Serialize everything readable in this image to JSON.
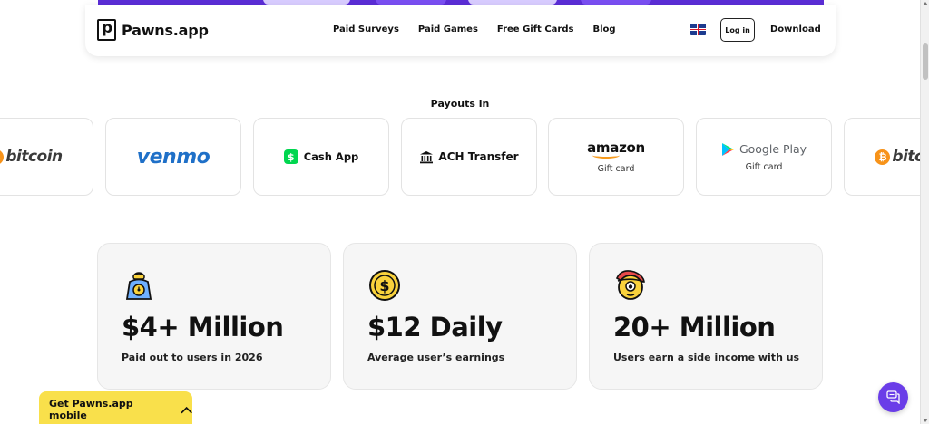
{
  "brand": {
    "name": "Pawns.app"
  },
  "nav": {
    "links": [
      "Paid Surveys",
      "Paid Games",
      "Free Gift Cards",
      "Blog"
    ],
    "language_icon": "uk-flag-icon",
    "login_label": "Log in",
    "download_label": "Download"
  },
  "payouts": {
    "title": "Payouts in",
    "methods": [
      {
        "name": "bitcoin"
      },
      {
        "name": "venmo"
      },
      {
        "name": "Cash App"
      },
      {
        "name": "ACH Transfer"
      },
      {
        "name": "amazon",
        "sub": "Gift card"
      },
      {
        "name": "Google Play",
        "sub": "Gift card"
      },
      {
        "name": "bitcoin"
      }
    ]
  },
  "stats": [
    {
      "value": "$4+ Million",
      "desc": "Paid out to users in 2026",
      "icon": "money-bag-icon"
    },
    {
      "value": "$12 Daily",
      "desc": "Average user’s earnings",
      "icon": "dollar-coin-icon"
    },
    {
      "value": "20+ Million",
      "desc": "Users earn a side income with us",
      "icon": "user-cap-icon"
    }
  ],
  "mobile_bar": {
    "label": "Get Pawns.app mobile",
    "icon": "chevron-up-icon"
  },
  "chat": {
    "icon": "chat-icon"
  },
  "colors": {
    "accent": "#6a3de8",
    "yellow": "#f9e04b",
    "card_bg": "#f6f6f6"
  }
}
